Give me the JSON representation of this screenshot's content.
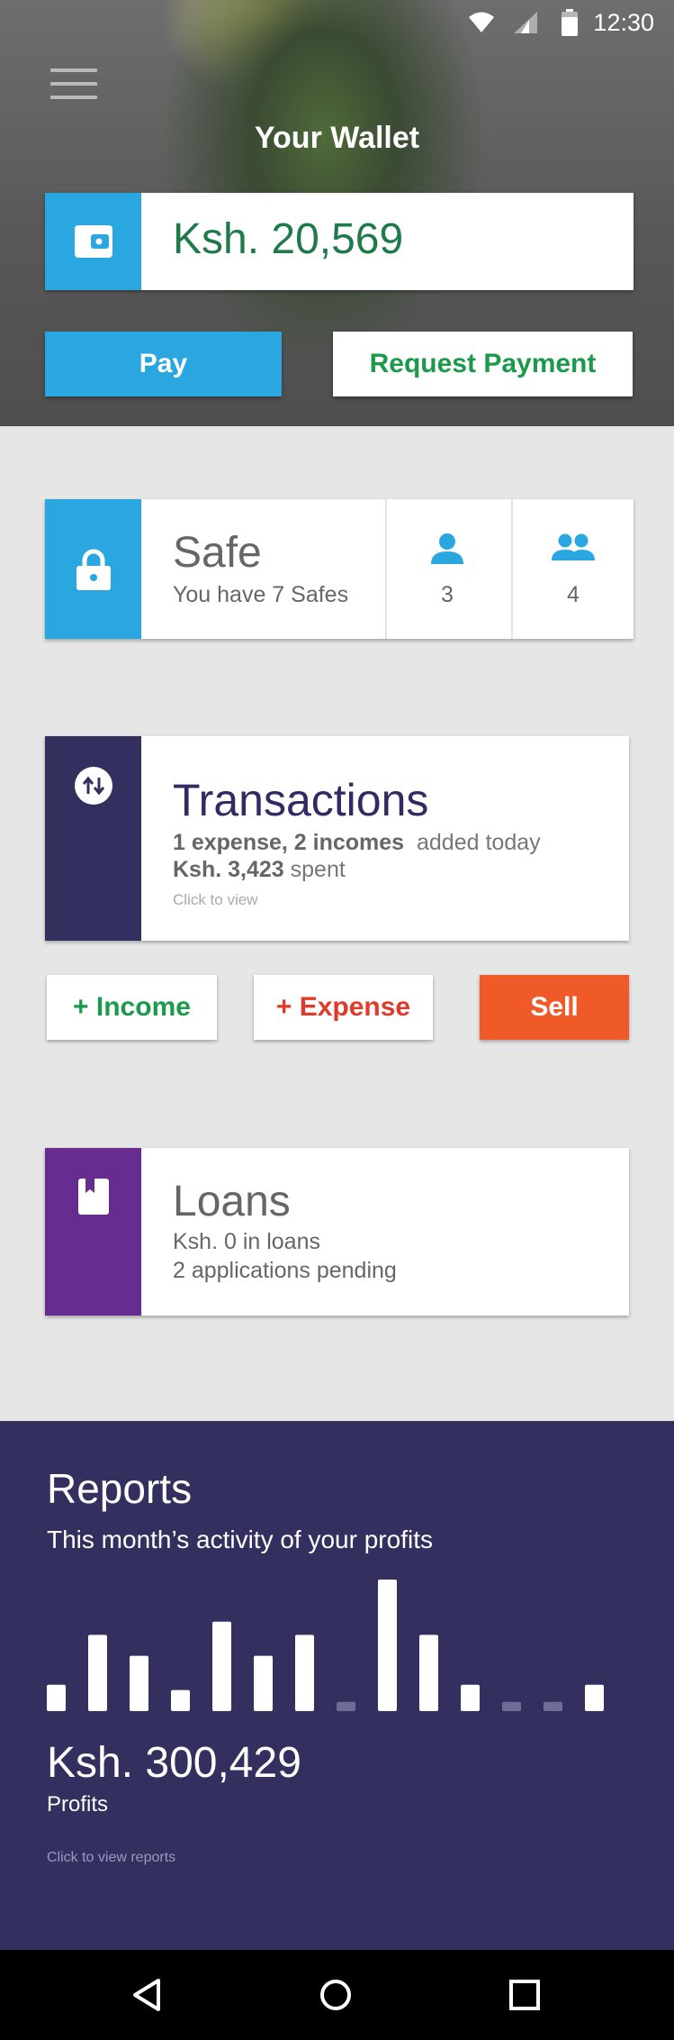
{
  "status_bar": {
    "time": "12:30",
    "icons": [
      "wifi-icon",
      "signal-icon",
      "battery-icon"
    ]
  },
  "header": {
    "menu_icon": "hamburger-menu-icon",
    "title": "Your Wallet",
    "balance": "Ksh. 20,569",
    "balance_icon": "wallet-icon",
    "pay_label": "Pay",
    "request_label": "Request Payment"
  },
  "safe": {
    "icon": "lock-icon",
    "title": "Safe",
    "subtitle": "You have 7 Safes",
    "person_count": "3",
    "group_count": "4"
  },
  "transactions": {
    "icon": "swap-vertical-icon",
    "title": "Transactions",
    "summary_bold": "1 expense, 2 incomes",
    "summary_rest": "added today",
    "spent_bold": "Ksh. 3,423",
    "spent_rest": "spent",
    "hint": "Click to view"
  },
  "actions": {
    "income_label": "+ Income",
    "expense_label": "+ Expense",
    "sell_label": "Sell"
  },
  "loans": {
    "icon": "book-icon",
    "title": "Loans",
    "line1": "Ksh. 0 in loans",
    "line2": "2 applications pending"
  },
  "reports": {
    "title": "Reports",
    "subtitle": "This month’s activity of your profits",
    "total": "Ksh. 300,429",
    "total_label": "Profits",
    "hint": "Click to view reports"
  },
  "chart_data": {
    "type": "bar",
    "values": [
      2.0,
      5.8,
      4.2,
      1.6,
      6.8,
      4.2,
      5.8,
      0.7,
      10.0,
      5.8,
      2.0,
      0.7,
      0.7,
      2.0
    ],
    "muted": [
      false,
      false,
      false,
      false,
      false,
      false,
      false,
      true,
      false,
      false,
      false,
      true,
      true,
      false
    ],
    "colors": {
      "bar": "#ffffff",
      "muted": "#6f6d97"
    }
  },
  "colors": {
    "blue": "#2aa6e0",
    "navy": "#33305f",
    "purple": "#662c90",
    "orange": "#f05a28",
    "green": "#1a9a4a",
    "red": "#e03a2a"
  }
}
